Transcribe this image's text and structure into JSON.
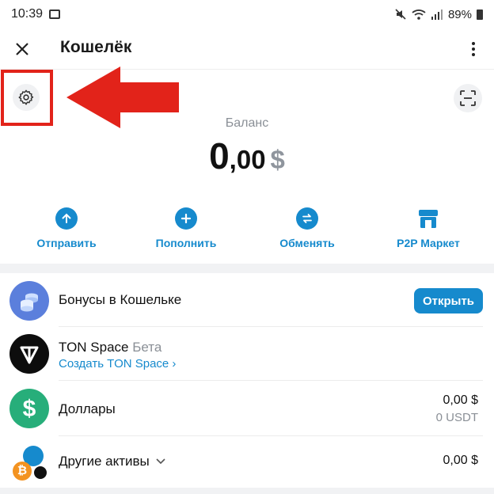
{
  "status": {
    "time": "10:39",
    "battery": "89%",
    "icons": [
      "gallery-icon",
      "mute-icon",
      "wifi-icon",
      "signal-icon",
      "battery-icon"
    ]
  },
  "header": {
    "title": "Кошелёк",
    "close_icon": "close-icon",
    "menu_icon": "more-vert-icon"
  },
  "balance": {
    "label": "Баланс",
    "integer": "0",
    "decimal": ",00",
    "currency": "$"
  },
  "actions": [
    {
      "label": "Отправить",
      "icon": "arrow-up-icon"
    },
    {
      "label": "Пополнить",
      "icon": "plus-icon"
    },
    {
      "label": "Обменять",
      "icon": "swap-icon"
    },
    {
      "label": "P2P Маркет",
      "icon": "store-icon"
    }
  ],
  "list": {
    "bonuses": {
      "name": "Бонусы в Кошельке",
      "button": "Открыть"
    },
    "ton_space": {
      "name": "TON Space",
      "badge": "Бета",
      "link": "Создать TON Space ›"
    },
    "dollars": {
      "name": "Доллары",
      "value": "0,00 $",
      "sub_value": "0 USDT"
    },
    "other": {
      "name": "Другие активы",
      "value": "0,00 $"
    }
  },
  "colors": {
    "accent": "#168acd",
    "highlight": "#e2231a",
    "usdt": "#27ae7a"
  }
}
